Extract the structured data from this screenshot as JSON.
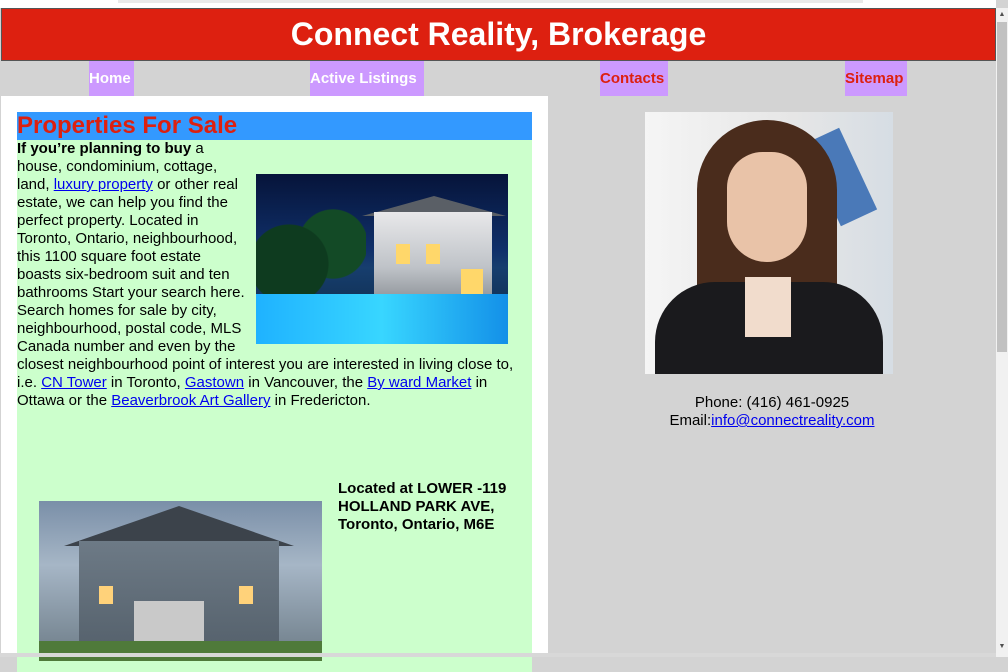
{
  "header": {
    "title": "Connect Reality, Brokerage"
  },
  "nav": [
    {
      "label": "Home"
    },
    {
      "label": "Active Listings"
    },
    {
      "label": "Contacts"
    },
    {
      "label": "Sitemap"
    }
  ],
  "main": {
    "section_title": "Properties For Sale",
    "intro_bold": "If you’re planning to buy",
    "text_1": " a house, condominium, cottage, land, ",
    "link_luxury": "luxury property",
    "text_2": " or other real estate, we can help you find the perfect property. Located in Toronto, Ontario, neighbourhood, this 1100 square foot estate boasts six-bedroom suit and ten bathrooms Start your search here. Search homes for sale by city, neighbourhood, postal code, MLS Canada number and even by the closest neighbourhood point of interest you are interested in living close to, i.e. ",
    "link_cn_tower": "CN Tower",
    "text_3": " in Toronto, ",
    "link_gastown": "Gastown",
    "text_4": " in Vancouver, the ",
    "link_byward": "By ward Market",
    "text_5": " in Ottawa or the ",
    "link_beaverbrook": "Beaverbrook Art Gallery",
    "text_6": " in Fredericton.",
    "location": "Located at LOWER -119 HOLLAND PARK AVE, Toronto, Ontario, M6E"
  },
  "contact": {
    "phone": "Phone: (416) 461-0925",
    "email_label": "Email:",
    "email_link": "info@connectreality.com"
  },
  "scrollbar": {
    "up_arrow": "▲",
    "down_arrow": "▼"
  },
  "colors": {
    "header_bg": "#dd2010",
    "nav_button_bg": "#cc99ff",
    "section_title_bg": "#3399ff",
    "content_bg": "#ccffcc",
    "page_bg": "#d3d3d3",
    "link": "#0000ee"
  }
}
